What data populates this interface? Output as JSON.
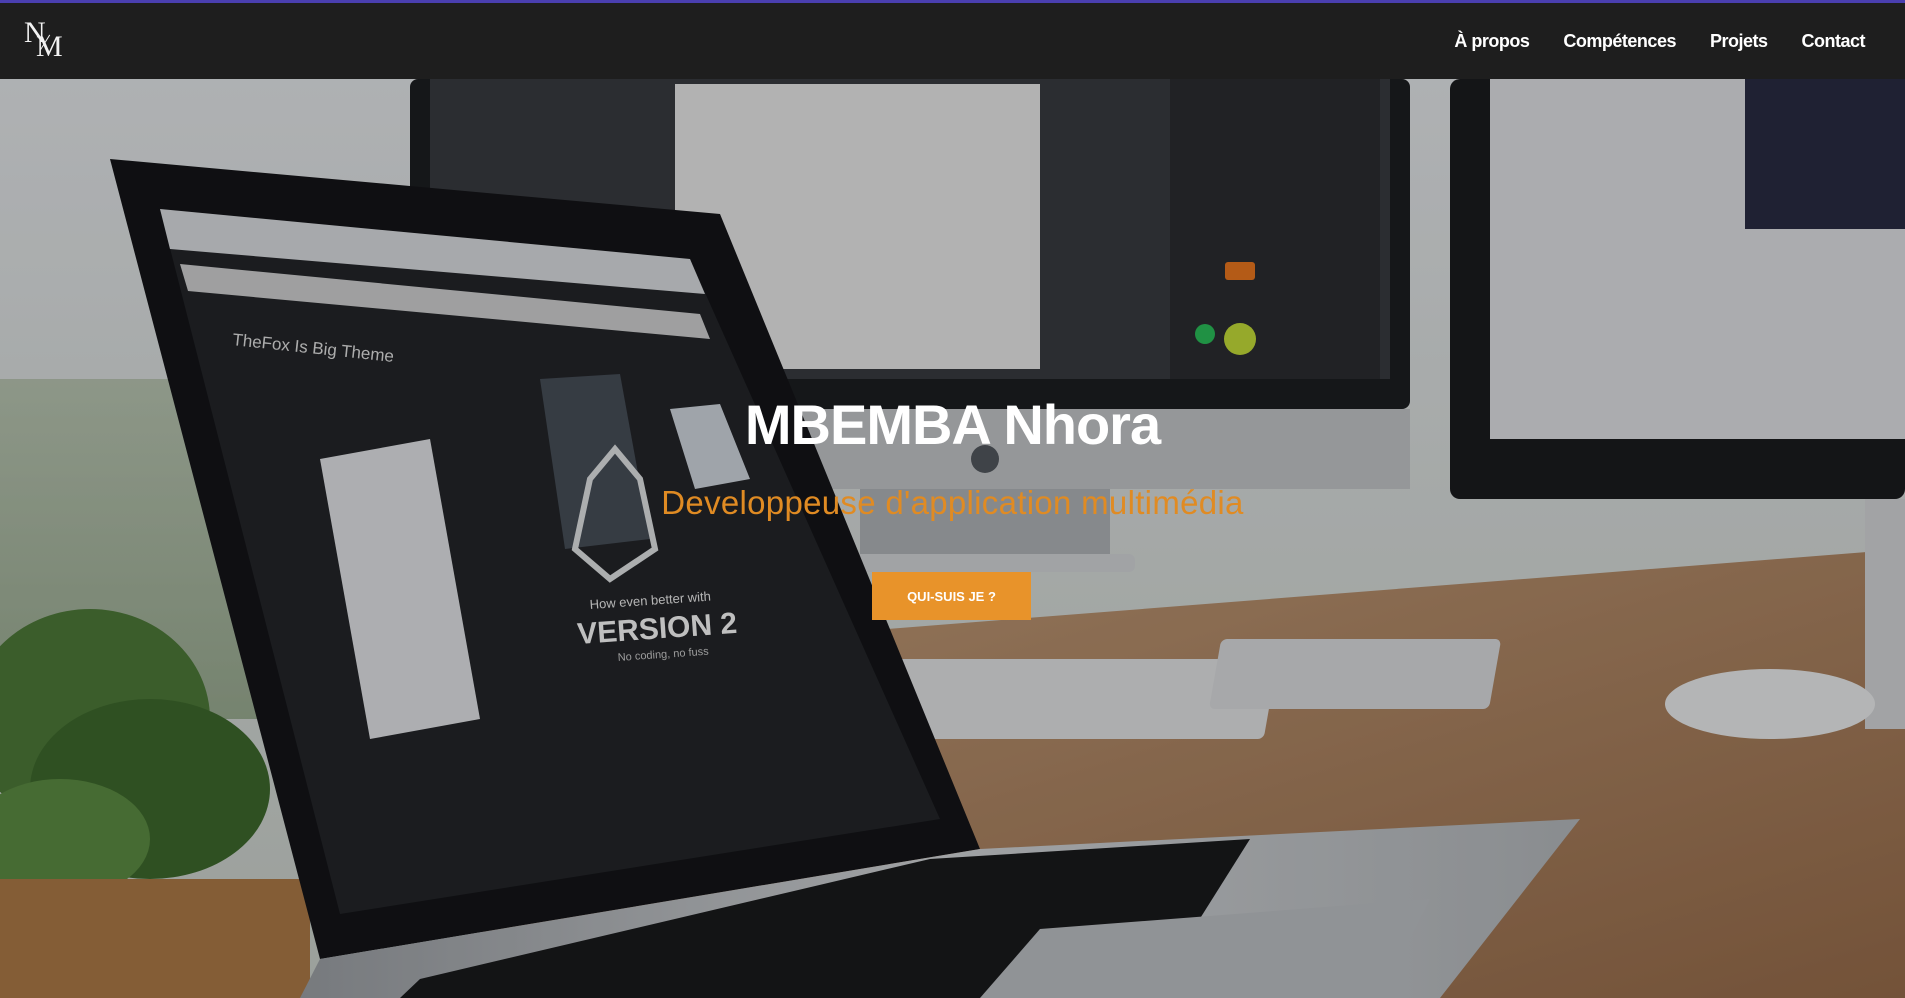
{
  "brand": {
    "logo_letter_top": "N",
    "logo_letter_bottom": "M"
  },
  "nav": {
    "items": [
      {
        "label": "À propos"
      },
      {
        "label": "Compétences"
      },
      {
        "label": "Projets"
      },
      {
        "label": "Contact"
      }
    ]
  },
  "hero": {
    "title": "MBEMBA Nhora",
    "subtitle": "Developpeuse d'application multimédia",
    "cta_label": "QUI-SUIS JE ?",
    "photo_screen_text": {
      "site_title": "TheFox Is Big Theme",
      "promo_line": "How even better with",
      "promo_version": "VERSION 2",
      "promo_tagline": "No coding, no fuss"
    }
  },
  "colors": {
    "navbar_bg": "#1e1e1e",
    "navbar_accent": "#4a3fb0",
    "subtitle": "#e08b23",
    "cta_bg": "#e8932a"
  }
}
